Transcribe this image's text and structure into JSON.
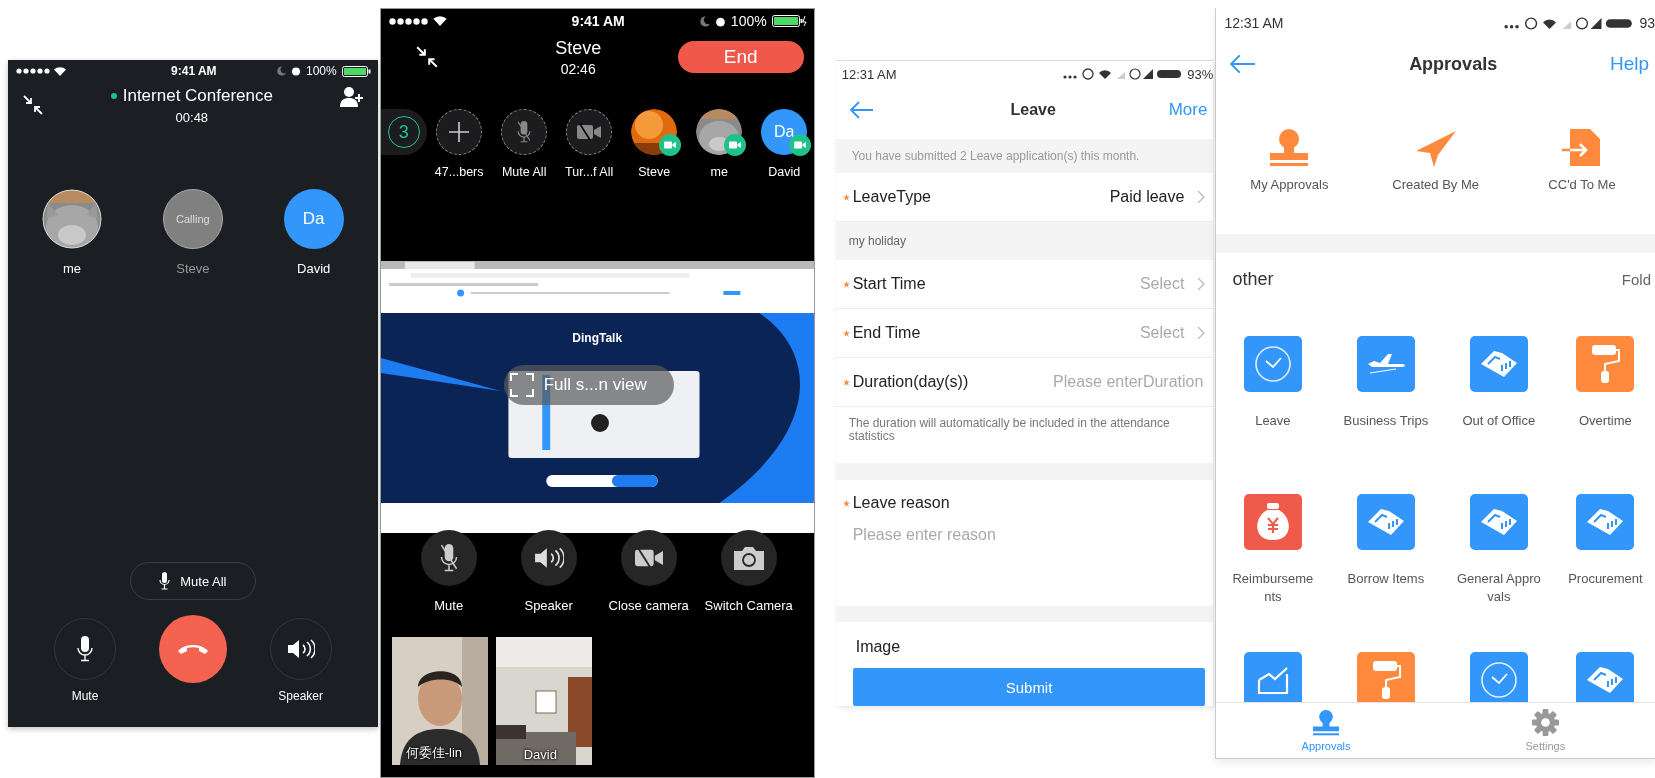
{
  "conference_call": {
    "status_bar": {
      "time": "9:41 AM",
      "battery": "100%"
    },
    "title": "Internet Conference",
    "duration": "00:48",
    "participants": [
      {
        "name": "me"
      },
      {
        "name": "Steve",
        "kind": "calling",
        "status": "Calling"
      },
      {
        "name": "David",
        "kind": "initials",
        "initials": "Da"
      }
    ],
    "mute_all": "Mute All",
    "controls": [
      {
        "kind": "mute",
        "label": "Mute"
      },
      {
        "kind": "hangup"
      },
      {
        "kind": "speaker",
        "label": "Speaker"
      }
    ]
  },
  "video_call": {
    "status_bar": {
      "time": "9:41 AM",
      "battery": "100%"
    },
    "caller": "Steve",
    "duration": "02:46",
    "end_button": "End",
    "member_count": "3",
    "members": [
      {
        "kind": "add",
        "label": "47...bers"
      },
      {
        "kind": "mute",
        "label": "Mute All"
      },
      {
        "kind": "camera-off",
        "label": "Tur...f All"
      },
      {
        "label": "Steve",
        "video_on": true
      },
      {
        "label": "me",
        "video_on": true
      },
      {
        "kind": "initials",
        "label": "David",
        "initials": "Da",
        "video_on": true
      }
    ],
    "shared_screen": {
      "heading": "DingTalk",
      "overlay": "Full s...n view"
    },
    "controls": [
      {
        "kind": "mute",
        "label": "Mute"
      },
      {
        "kind": "speaker",
        "label": "Speaker"
      },
      {
        "kind": "camera-off",
        "label": "Close camera"
      },
      {
        "kind": "switch-camera",
        "label": "Switch Camera"
      }
    ],
    "videos": [
      {
        "caption": "何委佳-lin"
      },
      {
        "caption": "David"
      }
    ]
  },
  "leave_form": {
    "status_bar": {
      "time": "12:31 AM",
      "battery": "93%"
    },
    "title": "Leave",
    "action": "More",
    "notice": "You have submitted 2 Leave application(s) this month.",
    "rows": [
      {
        "kind": "select",
        "label": "LeaveType",
        "required": true,
        "value": "Paid leave"
      },
      {
        "kind": "note",
        "text": "my holiday"
      },
      {
        "kind": "select",
        "label": "Start Time",
        "required": true,
        "placeholder": "Select"
      },
      {
        "kind": "select",
        "label": "End Time",
        "required": true,
        "placeholder": "Select"
      },
      {
        "kind": "input",
        "label": "Duration(day(s))",
        "required": true,
        "placeholder": "Please enterDuration"
      },
      {
        "kind": "hint",
        "text": "The duration will automatically be included in the attendance statistics"
      },
      {
        "kind": "textarea",
        "label": "Leave reason",
        "required": true,
        "placeholder": "Please enter reason"
      },
      {
        "label": "Image"
      }
    ],
    "submit": "Submit"
  },
  "approvals": {
    "status_bar": {
      "time": "12:31 AM",
      "battery": "93"
    },
    "title": "Approvals",
    "action": "Help",
    "shortcuts": [
      {
        "kind": "stamp",
        "label": "My Approvals"
      },
      {
        "kind": "plane",
        "label": "Created By Me"
      },
      {
        "kind": "document",
        "label": "CC'd To Me"
      }
    ],
    "section": {
      "title": "other",
      "action": "Fold"
    },
    "items": [
      {
        "kind": "clock",
        "label": "Leave",
        "color": "#3296fa"
      },
      {
        "kind": "plane",
        "label": "Business Trips",
        "color": "#3296fa"
      },
      {
        "kind": "handshake",
        "label": "Out of Office",
        "color": "#3296fa"
      },
      {
        "kind": "roller",
        "label": "Overtime",
        "color": "#ff8a3d"
      },
      {
        "kind": "moneybag",
        "label": "Reimbursements",
        "color": "#f05a4a"
      },
      {
        "kind": "handshake",
        "label": "Borrow Items",
        "color": "#3296fa"
      },
      {
        "kind": "handshake",
        "label": "General Approvals",
        "color": "#3296fa"
      },
      {
        "kind": "handshake",
        "label": "Procurement",
        "color": "#3296fa"
      },
      {
        "kind": "chart",
        "color": "#3296fa"
      },
      {
        "kind": "roller",
        "color": "#ff8a3d"
      },
      {
        "kind": "clock",
        "color": "#3296fa"
      },
      {
        "kind": "handshake",
        "color": "#3296fa"
      }
    ],
    "tabs": [
      {
        "kind": "stamp",
        "label": "Approvals",
        "selected": true
      },
      {
        "kind": "gear",
        "label": "Settings",
        "selected": false
      }
    ]
  }
}
